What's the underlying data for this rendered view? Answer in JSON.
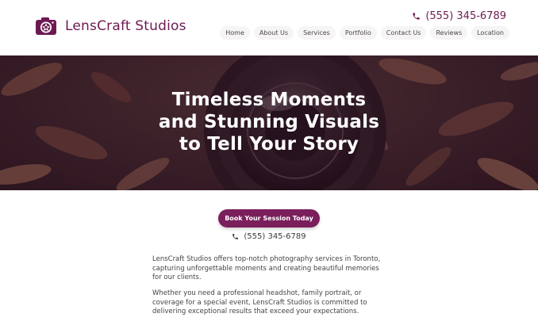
{
  "header": {
    "brand_name": "LensCraft Studios",
    "phone": "(555) 345-6789",
    "nav": [
      "Home",
      "About Us",
      "Services",
      "Portfolio",
      "Contact Us",
      "Reviews",
      "Location"
    ]
  },
  "hero": {
    "title_lines": [
      "Timeless Moments",
      "and Stunning Visuals",
      "to Tell Your Story"
    ]
  },
  "cta": {
    "label": "Book Your Session Today"
  },
  "contact": {
    "phone": "(555) 345-6789"
  },
  "intro": {
    "paragraphs": [
      "LensCraft Studios offers top-notch photography services in Toronto, capturing unforgettable moments and creating beautiful memories for our clients.",
      "Whether you need a professional headshot, family portrait, or coverage for a special event, LensCraft Studios is committed to delivering exceptional results that exceed your expectations."
    ]
  },
  "icons": {
    "logo": "camera-aperture-icon",
    "phone": "phone-icon"
  },
  "colors": {
    "brand": "#6e1a52",
    "button": "#7a1f5c",
    "hero_overlay": "#46143a"
  }
}
